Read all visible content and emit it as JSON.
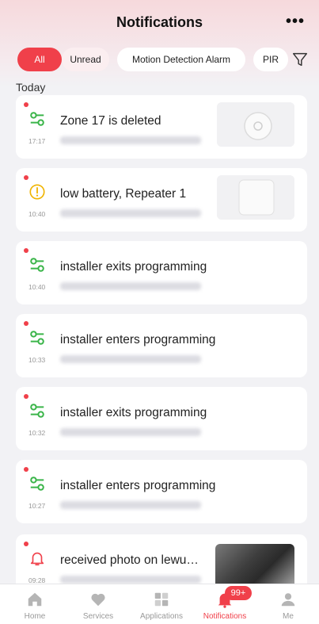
{
  "header": {
    "title": "Notifications",
    "more_label": "•••"
  },
  "filters": {
    "chips": [
      "All",
      "Unread",
      "Motion Detection Alarm",
      "PIR"
    ],
    "active": "All"
  },
  "section": {
    "title": "Today"
  },
  "notifications": [
    {
      "icon": "zone-icon",
      "message": "Zone 17 is deleted",
      "time": "17:17",
      "unread": true,
      "thumbnail": "siren-device"
    },
    {
      "icon": "warning-icon",
      "message": "low battery, Repeater 1",
      "time": "10:40",
      "unread": true,
      "thumbnail": "repeater-device"
    },
    {
      "icon": "zone-icon",
      "message": "installer exits programming",
      "time": "10:40",
      "unread": true
    },
    {
      "icon": "zone-icon",
      "message": "installer enters programming",
      "time": "10:33",
      "unread": true
    },
    {
      "icon": "zone-icon",
      "message": "installer exits programming",
      "time": "10:32",
      "unread": true
    },
    {
      "icon": "zone-icon",
      "message": "installer enters programming",
      "time": "10:27",
      "unread": true
    },
    {
      "icon": "bell-icon",
      "message": "received photo on lewu…",
      "time": "09:28",
      "unread": true,
      "thumbnail": "photo"
    }
  ],
  "tabbar": {
    "tabs": [
      {
        "label": "Home",
        "icon": "home-icon"
      },
      {
        "label": "Services",
        "icon": "heart-icon"
      },
      {
        "label": "Applications",
        "icon": "apps-icon"
      },
      {
        "label": "Notifications",
        "icon": "bell-icon"
      },
      {
        "label": "Me",
        "icon": "person-icon"
      }
    ],
    "active": "Notifications",
    "badge": "99+"
  },
  "colors": {
    "accent": "#f0404a",
    "success": "#3bb54a",
    "warning": "#f0b400"
  }
}
